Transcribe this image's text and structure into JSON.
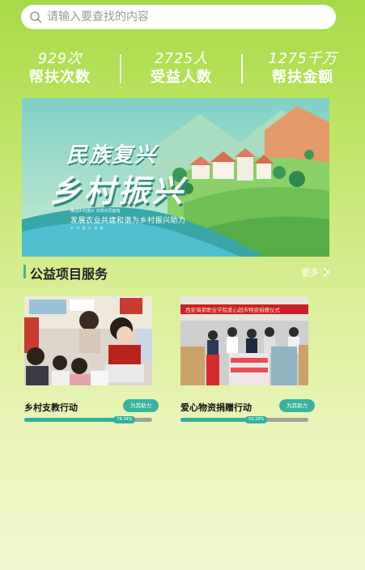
{
  "search": {
    "placeholder": "请输入要查找的内容",
    "icon": "search-icon"
  },
  "stats": [
    {
      "value": "929次",
      "label": "帮扶次数"
    },
    {
      "value": "2725人",
      "label": "受益人数"
    },
    {
      "value": "1275千万",
      "label": "帮扶金额"
    }
  ],
  "banner": {
    "title_line1": "民族复兴",
    "title_line2": "乡村振兴",
    "small_text": "推动乡村振兴 实现共同富裕",
    "subtitle": "发展农业共建和谐为乡村振兴助力",
    "tag": "乡 村 振 兴 战 略"
  },
  "section": {
    "title": "公益项目服务",
    "more_label": "更多"
  },
  "projects": [
    {
      "title": "乡村支教行动",
      "button": "为其助力",
      "progress": 0.7834,
      "progress_label": "78.34%"
    },
    {
      "title": "爱心物资捐赠行动",
      "button": "为其助力",
      "progress": 0.5928,
      "progress_label": "59.28%"
    }
  ],
  "photo2_banner": "西安海棠职业学院爱心超市物资捐赠仪式",
  "colors": {
    "accent": "#39b39e",
    "background_top": "#a6d94a",
    "background_bottom": "#f3f7cf"
  }
}
